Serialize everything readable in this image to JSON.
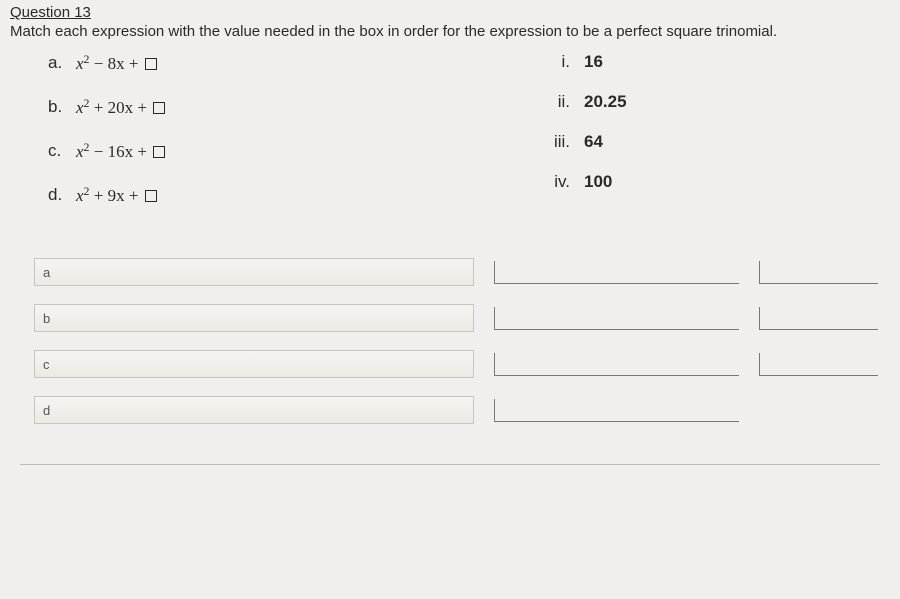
{
  "question": {
    "title": "Question 13",
    "prompt": "Match each expression with the value needed in the box in order for the expression to be a perfect square trinomial."
  },
  "expressions": [
    {
      "label": "a.",
      "pre": "x",
      "exp": "2",
      "mid": " − 8x + "
    },
    {
      "label": "b.",
      "pre": "x",
      "exp": "2",
      "mid": " + 20x + "
    },
    {
      "label": "c.",
      "pre": "x",
      "exp": "2",
      "mid": " − 16x + "
    },
    {
      "label": "d.",
      "pre": "x",
      "exp": "2",
      "mid": " + 9x + "
    }
  ],
  "answers": [
    {
      "label": "i.",
      "value": "16"
    },
    {
      "label": "ii.",
      "value": "20.25"
    },
    {
      "label": "iii.",
      "value": "64"
    },
    {
      "label": "iv.",
      "value": "100"
    }
  ],
  "input_rows": [
    {
      "prefix": "a"
    },
    {
      "prefix": "b"
    },
    {
      "prefix": "c"
    },
    {
      "prefix": "d"
    }
  ]
}
